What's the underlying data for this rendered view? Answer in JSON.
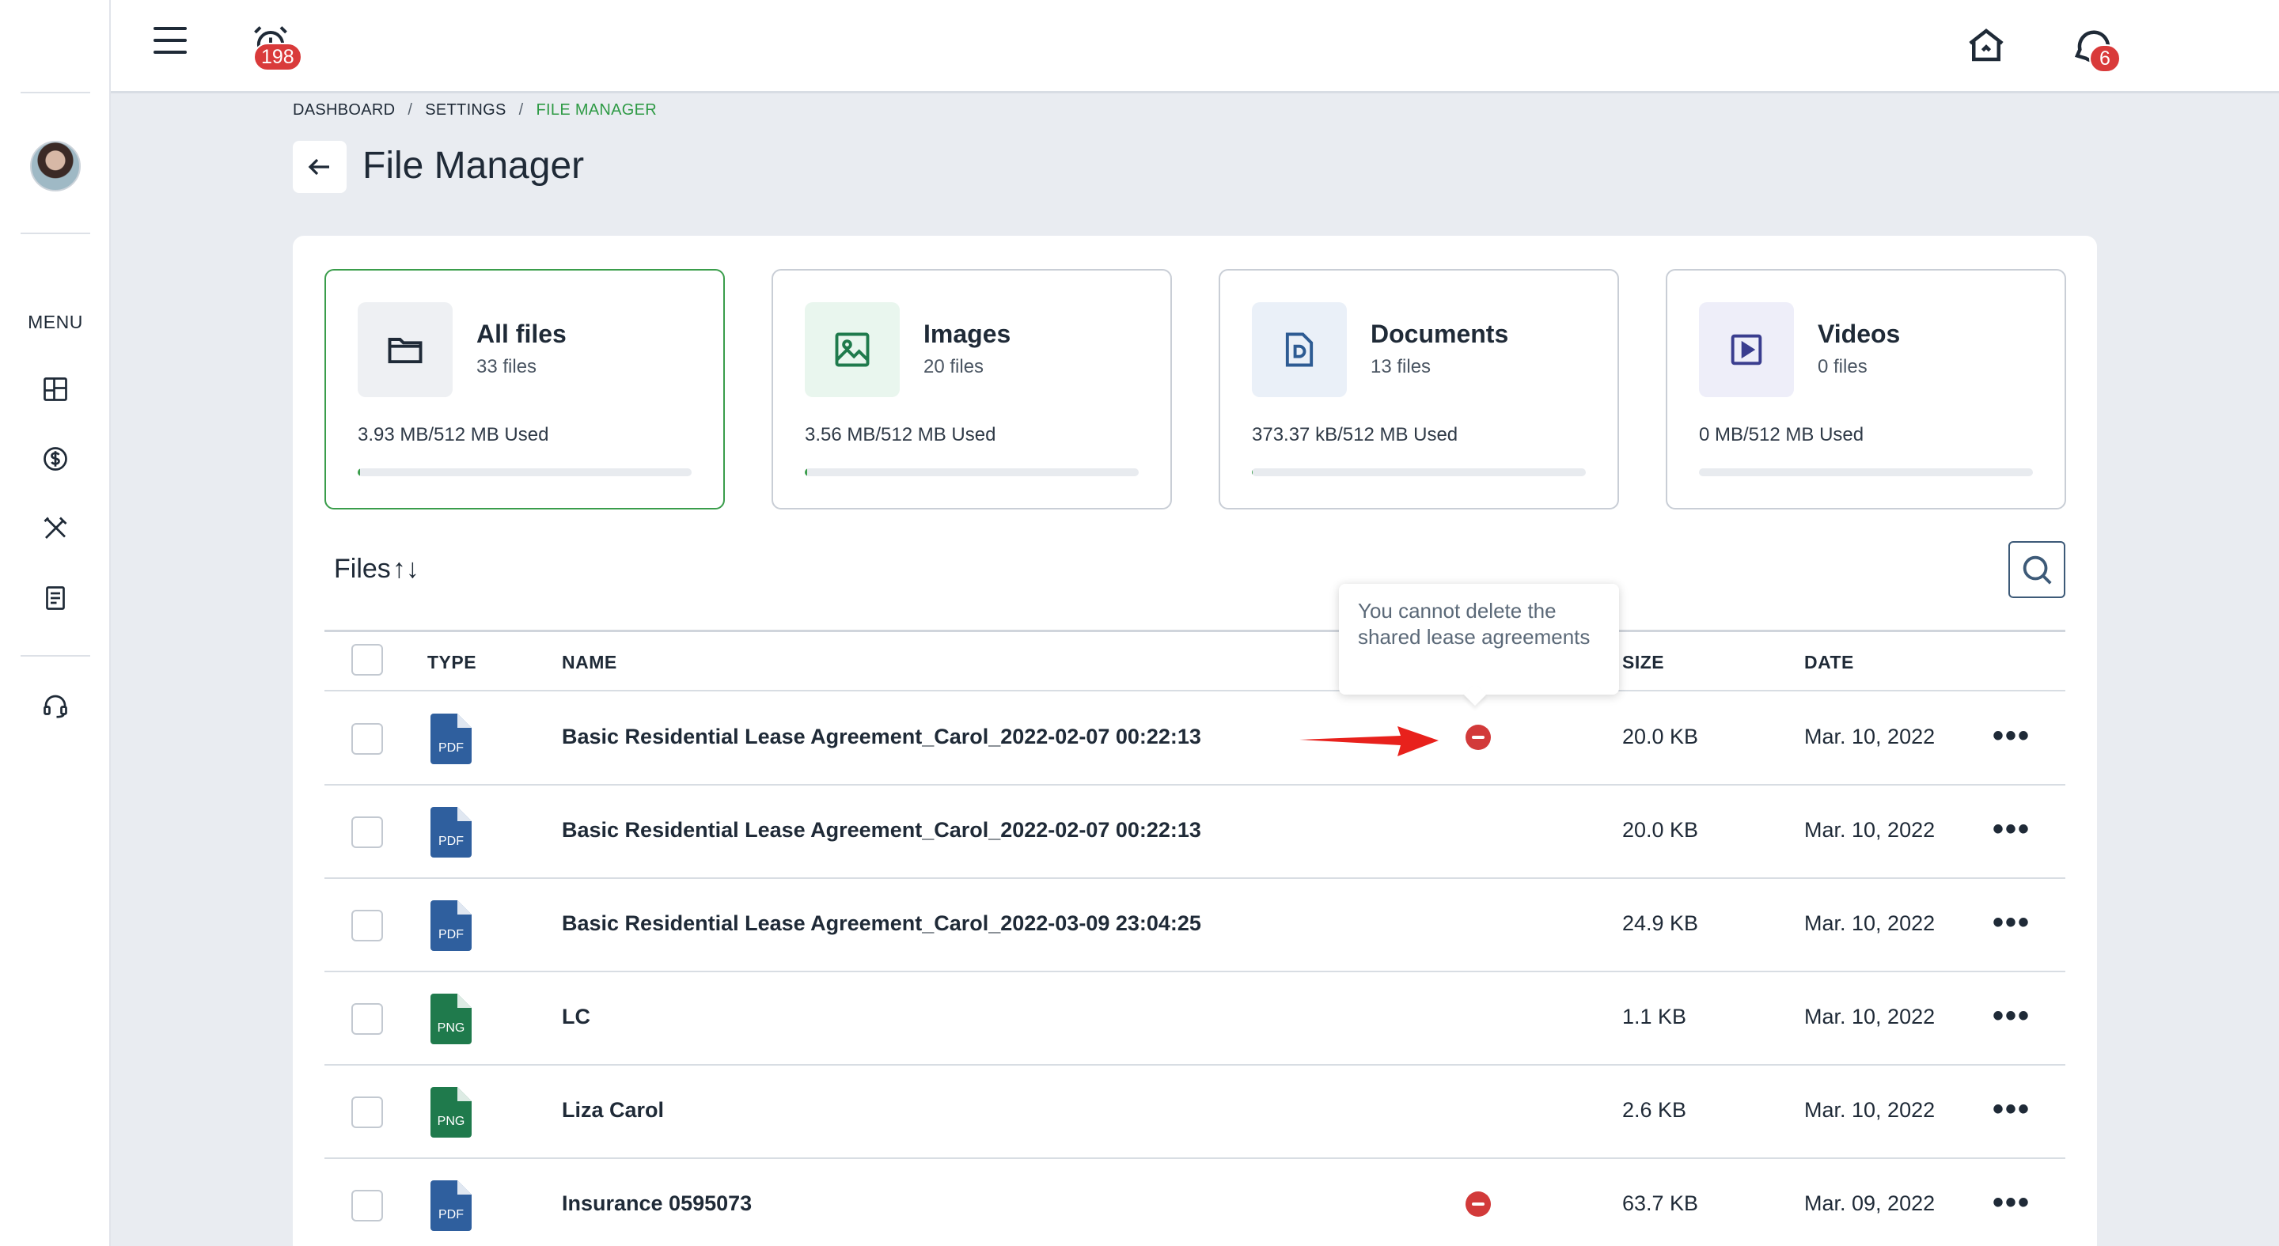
{
  "sidebar": {
    "menu_label": "MENU",
    "icons": [
      "dashboard-icon",
      "dollar-icon",
      "tools-icon",
      "document-icon",
      "support-icon"
    ]
  },
  "topbar": {
    "alarm_badge": "198",
    "messages_badge": "6",
    "icons": [
      "menu-icon",
      "alarm-clock-icon",
      "home-icon",
      "chat-icon",
      "gear-icon"
    ],
    "accent_color": "#2e9a45"
  },
  "breadcrumb": {
    "items": [
      "DASHBOARD",
      "SETTINGS",
      "FILE MANAGER"
    ]
  },
  "page": {
    "title": "File Manager"
  },
  "categories": [
    {
      "title": "All files",
      "count": "33 files",
      "used": "3.93 MB/512 MB Used",
      "usage_fraction": 0.0077
    },
    {
      "title": "Images",
      "count": "20 files",
      "used": "3.56 MB/512 MB Used",
      "usage_fraction": 0.007
    },
    {
      "title": "Documents",
      "count": "13 files",
      "used": "373.37 kB/512 MB Used",
      "usage_fraction": 0.0007
    },
    {
      "title": "Videos",
      "count": "0 files",
      "used": "0 MB/512 MB Used",
      "usage_fraction": 0
    }
  ],
  "files_section": {
    "title": "Files"
  },
  "table": {
    "headers": {
      "type": "TYPE",
      "name": "NAME",
      "size": "SIZE",
      "date": "DATE"
    },
    "rows": [
      {
        "type": "PDF",
        "name": "Basic Residential Lease Agreement_Carol_2022-02-07 00:22:13",
        "size": "20.0 KB",
        "date": "Mar. 10, 2022",
        "more": "•••"
      },
      {
        "type": "PDF",
        "name": "Basic Residential Lease Agreement_Carol_2022-02-07 00:22:13",
        "size": "20.0 KB",
        "date": "Mar. 10, 2022",
        "more": "•••"
      },
      {
        "type": "PDF",
        "name": "Basic Residential Lease Agreement_Carol_2022-03-09 23:04:25",
        "size": "24.9 KB",
        "date": "Mar. 10, 2022",
        "more": "•••"
      },
      {
        "type": "PNG",
        "name": "LC",
        "size": "1.1 KB",
        "date": "Mar. 10, 2022",
        "more": "•••"
      },
      {
        "type": "PNG",
        "name": "Liza Carol",
        "size": "2.6 KB",
        "date": "Mar. 10, 2022",
        "more": "•••"
      },
      {
        "type": "PDF",
        "name": "Insurance 0595073",
        "size": "63.7 KB",
        "date": "Mar. 09, 2022",
        "more": "•••"
      }
    ]
  },
  "tooltip": {
    "text": "You cannot delete the shared lease agreements"
  }
}
